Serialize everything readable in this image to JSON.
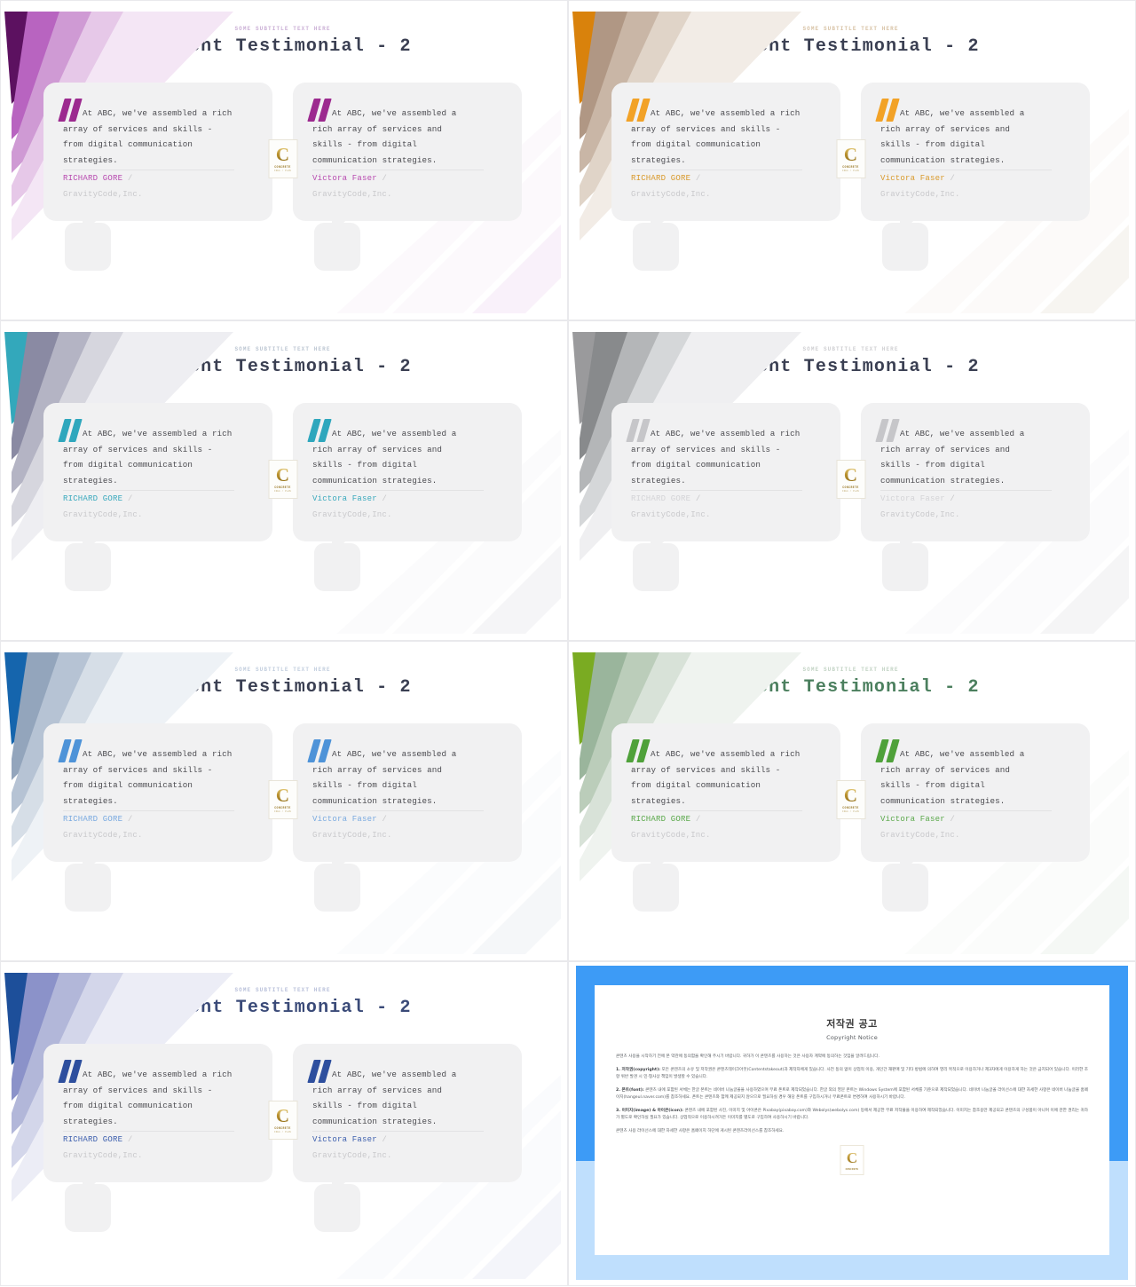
{
  "deck": {
    "slide_count": 8,
    "common": {
      "subtitle": "SOME SUBTITLE TEXT HERE",
      "title": "Client Testimonial - 2",
      "logo": {
        "letter": "C",
        "name": "CONCRETE",
        "tagline": "IDEA / PLAN"
      },
      "quote_left": {
        "lines": [
          "At ABC, we've assembled a rich",
          "array of services and skills -",
          "from digital communication",
          "strategies."
        ],
        "author": "RICHARD GORE",
        "separator": "/",
        "company": "GravityCode,Inc."
      },
      "quote_right": {
        "lines": [
          "At ABC, we've assembled a",
          "rich array of services and",
          "skills - from digital",
          "communication strategies."
        ],
        "author": "Victora Faser",
        "separator": "/",
        "company": "GravityCode,Inc."
      }
    },
    "slides": [
      {
        "id": "slide-purple",
        "theme_name": "purple",
        "accent": "#9c2a8f",
        "quote_color": "#9c2a8f",
        "author_color": "#b84bb0",
        "title_color": "#3a3f52",
        "subtitle_color": "#cbb0d6",
        "ribbon": [
          "#5c1160",
          "#b864c0",
          "#cf9ad4",
          "#e6c8e8",
          "#f4e6f5"
        ]
      },
      {
        "id": "slide-orange",
        "theme_name": "orange",
        "accent": "#f0a020",
        "quote_color": "#f2a227",
        "author_color": "#d99a2c",
        "title_color": "#3a3f52",
        "subtitle_color": "#d8c3a6",
        "ribbon": [
          "#d9820c",
          "#b09784",
          "#c9b6a6",
          "#e0d4c8",
          "#f2ece6"
        ]
      },
      {
        "id": "slide-teal",
        "theme_name": "teal",
        "accent": "#2fa7bd",
        "quote_color": "#2fa7bd",
        "author_color": "#3aa9bd",
        "title_color": "#3a3f52",
        "subtitle_color": "#bcc6d2",
        "ribbon": [
          "#33a8bb",
          "#8a8aa3",
          "#b4b4c4",
          "#d6d6de",
          "#eeeef2"
        ]
      },
      {
        "id": "slide-gray",
        "theme_name": "gray",
        "accent": "#b4b4b6",
        "quote_color": "#c6c6c9",
        "author_color": "#d4d4d7",
        "title_color": "#3a3f52",
        "subtitle_color": "#cfcfd2",
        "ribbon": [
          "#9a9a9c",
          "#888a8c",
          "#b4b6b8",
          "#d5d7d9",
          "#efeff1"
        ]
      },
      {
        "id": "slide-blue",
        "theme_name": "blue",
        "accent": "#2f7fd0",
        "quote_color": "#4e93d8",
        "author_color": "#7aaae0",
        "title_color": "#3a3f52",
        "subtitle_color": "#c2cede",
        "ribbon": [
          "#1565ad",
          "#93a5bc",
          "#b6c3d4",
          "#d6dee7",
          "#eef2f6"
        ]
      },
      {
        "id": "slide-green",
        "theme_name": "green",
        "accent": "#4fa13a",
        "quote_color": "#4fa13a",
        "author_color": "#5aa84a",
        "title_color": "#4b7f5e",
        "subtitle_color": "#c2d3c4",
        "ribbon": [
          "#7aab22",
          "#9ab59c",
          "#bbcdba",
          "#d8e2d8",
          "#eff3ef"
        ]
      },
      {
        "id": "slide-navy",
        "theme_name": "navy",
        "accent": "#2e4f9e",
        "quote_color": "#2e4f9e",
        "author_color": "#3d5fae",
        "title_color": "#3a4a78",
        "subtitle_color": "#b9c0da",
        "ribbon": [
          "#1d4f9a",
          "#8b92c9",
          "#b2b7d9",
          "#d3d6ea",
          "#ecedf6"
        ]
      }
    ],
    "copyright_slide": {
      "id": "slide-copyright",
      "band_top_color": "#3d9bf6",
      "band_bottom_color": "#bfdffd",
      "title_ko": "저작권 공고",
      "title_en": "Copyright Notice",
      "logo": {
        "letter": "C",
        "name": "CONCRETE"
      },
      "paragraphs": [
        "콘텐츠 사용을 시작하기 전에 본 약관에 동의함을 확인해 주시기 바랍니다. 귀하가 이 콘텐츠를 사용하는 것은 사용자 계약에 동의하는 것임을 알려드립니다.",
        "1. 저작권(copyright): 모든 콘텐츠의 소유 및 저작권은 콘텐츠테이크아웃(Contentstakeout)과 제작자에게 있습니다. 사전 동의 없이 상업적 이용, 개인간 재판매 및 기타 방법에 의하여 영리 목적으로 이용하거나 제3자에게 이용하게 하는 것은 금지되어 있습니다. 이러한 조항 위반 발견 시 민·형사상 책임이 발생할 수 있습니다.",
        "2. 폰트(font): 콘텐츠 내에 포함된 서체는 한글 폰트는 네이버 나눔글꼴을 사용하였으며 무료 폰트로 제작되었습니다. 한글 외의 영문 폰트는 Windows System에 포함된 서체를 기준으로 제작되었습니다. 네이버 나눔글꼴 라이선스에 대한 자세한 사항은 네이버 나눔글꼴 홈페이지(hangeul.naver.com)를 참조하세요. 폰트는 콘텐츠와 함께 제공되지 않으므로 필요하실 경우 해당 폰트를 구입하시거나 무료폰트로 변경하여 사용하시기 바랍니다.",
        "3. 이미지(image) & 아이콘(icon): 콘텐츠 내에 포함된 사진, 이미지 및 아이콘은 Pixabay(pixabay.com)와 Webolys(webolys.com) 등에서 제공한 무료 저작물을 이용하여 제작되었습니다. 이미지는 참조용만 제공되고 콘텐츠의 구성품이 아니며 이에 관한 권리는 귀하가 별도로 확인하실 필요가 있습니다. 상업적으로 이용하시려거든 이미지를 별도로 구입하여 사용하시기 바랍니다.",
        "콘텐츠 사용 라이선스에 대한 자세한 사항은 홈페이지 하단에 게시된 콘텐츠라이선스를 참조하세요."
      ]
    }
  }
}
